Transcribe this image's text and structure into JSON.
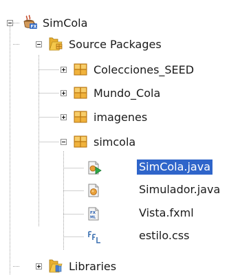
{
  "tree": {
    "project": {
      "label": "SimCola",
      "icon": "coffee-cup-project-icon"
    },
    "source_packages": {
      "label": "Source Packages",
      "icon": "source-folder-icon"
    },
    "packages": [
      {
        "label": "Colecciones_SEED",
        "icon": "package-icon"
      },
      {
        "label": "Mundo_Cola",
        "icon": "package-icon"
      },
      {
        "label": "imagenes",
        "icon": "package-icon"
      },
      {
        "label": "simcola",
        "icon": "package-icon"
      }
    ],
    "files": [
      {
        "label": "SimCola.java",
        "icon": "java-main-class-icon"
      },
      {
        "label": "Simulador.java",
        "icon": "java-class-icon"
      },
      {
        "label": "Vista.fxml",
        "icon": "fxml-file-icon"
      },
      {
        "label": "estilo.css",
        "icon": "css-file-icon"
      }
    ],
    "libraries": {
      "label": "Libraries",
      "icon": "libraries-folder-icon"
    }
  },
  "colors": {
    "selection": "#2f65ca",
    "guide_line": "#a0a0a0",
    "package_orange": "#f0b23c",
    "folder_yellow": "#f5c84a"
  }
}
